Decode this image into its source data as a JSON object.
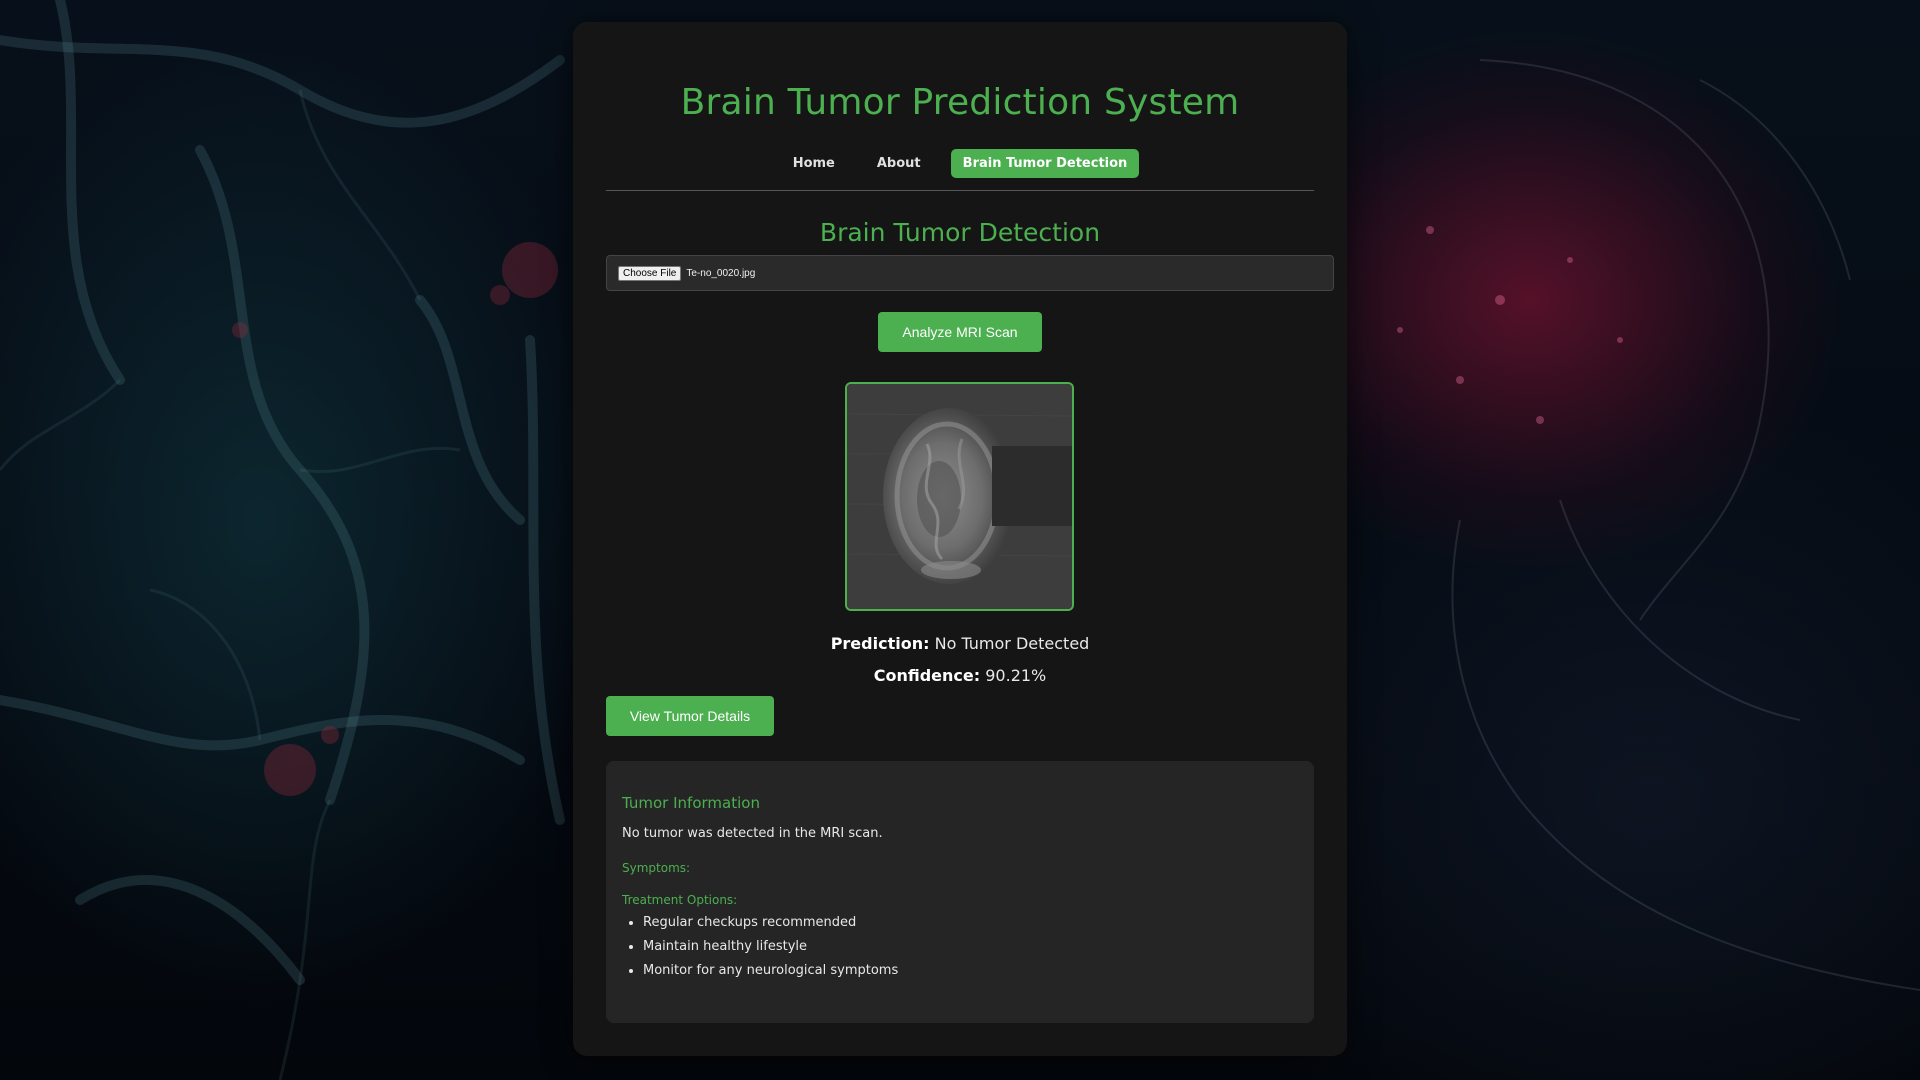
{
  "header": {
    "title": "Brain Tumor Prediction System"
  },
  "nav": {
    "items": [
      {
        "label": "Home",
        "active": false
      },
      {
        "label": "About",
        "active": false
      },
      {
        "label": "Brain Tumor Detection",
        "active": true
      }
    ]
  },
  "detection": {
    "section_title": "Brain Tumor Detection",
    "file_input": {
      "button_label": "Choose File",
      "file_name": "Te-no_0020.jpg"
    },
    "analyze_label": "Analyze MRI Scan",
    "result": {
      "prediction_label": "Prediction:",
      "prediction_value": "No Tumor Detected",
      "confidence_label": "Confidence:",
      "confidence_value": "90.21%"
    },
    "details_button_label": "View Tumor Details"
  },
  "tumor_info": {
    "title": "Tumor Information",
    "description": "No tumor was detected in the MRI scan.",
    "symptoms_label": "Symptoms:",
    "treatment_label": "Treatment Options:",
    "treatments": [
      "Regular checkups recommended",
      "Maintain healthy lifestyle",
      "Monitor for any neurological symptoms"
    ]
  },
  "colors": {
    "accent": "#4caf50",
    "panel": "#151515",
    "info_box": "#252525"
  }
}
